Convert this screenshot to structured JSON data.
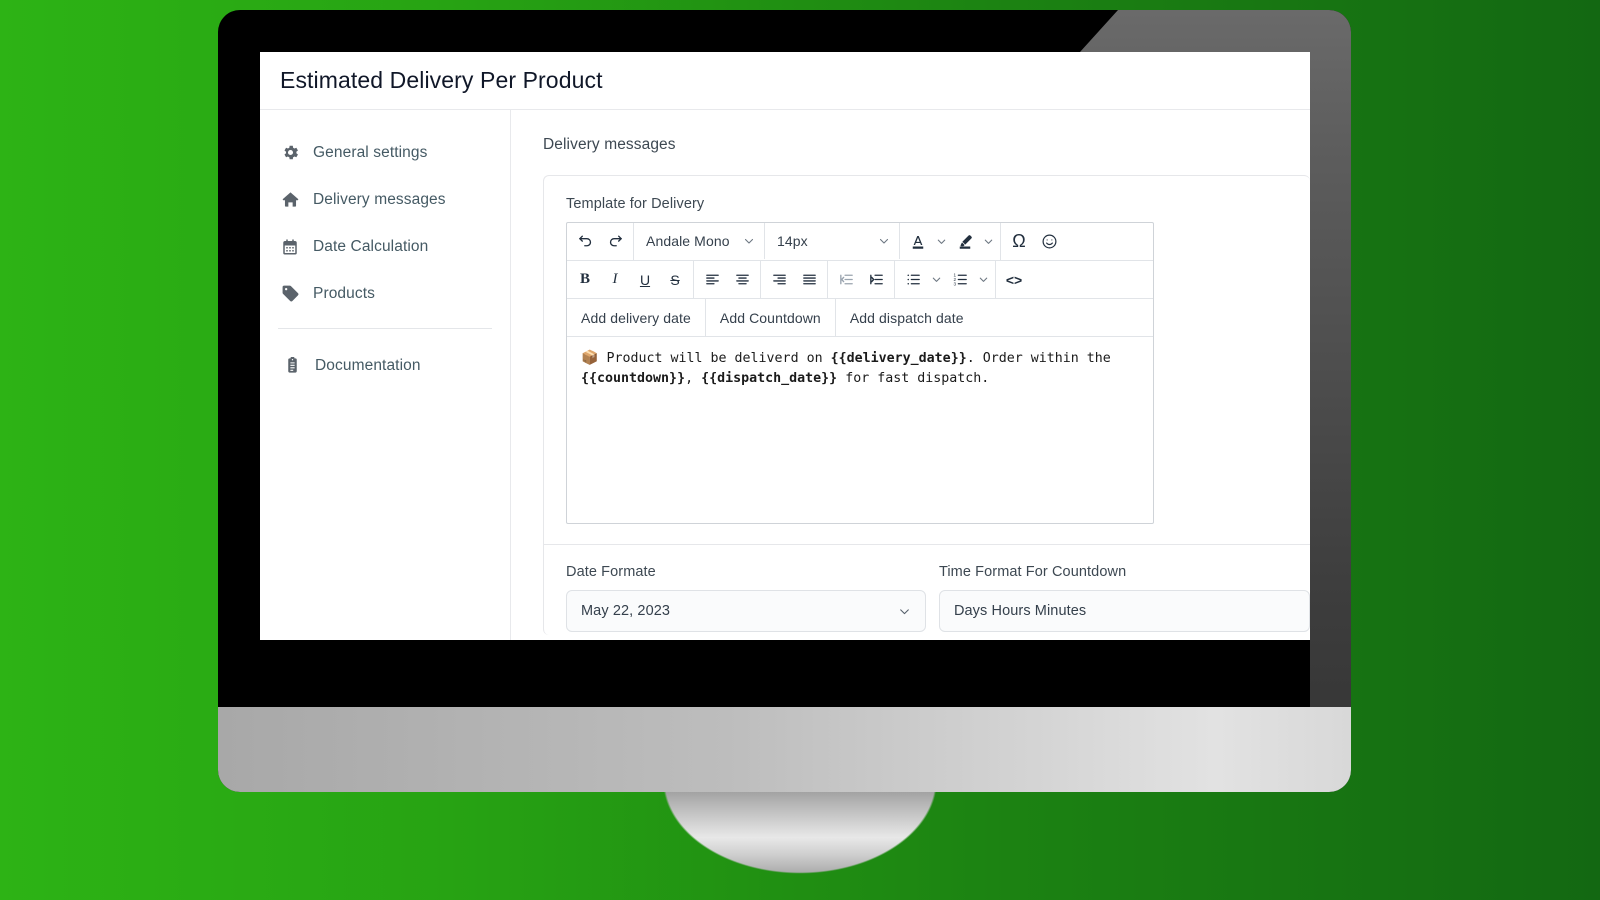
{
  "app": {
    "title": "Estimated Delivery Per Product"
  },
  "sidebar": {
    "items": [
      {
        "label": "General settings",
        "icon": "gear-icon"
      },
      {
        "label": "Delivery messages",
        "icon": "home-icon"
      },
      {
        "label": "Date Calculation",
        "icon": "calendar-icon"
      },
      {
        "label": "Products",
        "icon": "tag-icon"
      }
    ],
    "footer": {
      "label": "Documentation",
      "icon": "clipboard-icon"
    }
  },
  "main": {
    "section_title": "Delivery messages",
    "editor": {
      "label": "Template for Delivery",
      "font_family": "Andale Mono",
      "font_size": "14px",
      "toolbar_row1": [
        {
          "name": "undo-icon"
        },
        {
          "name": "redo-icon"
        },
        {
          "name": "text-color-icon"
        },
        {
          "name": "highlight-color-icon"
        },
        {
          "name": "special-character-icon",
          "glyph": "Ω"
        },
        {
          "name": "emoji-icon"
        }
      ],
      "toolbar_row2": [
        {
          "name": "bold-icon",
          "glyph": "B"
        },
        {
          "name": "italic-icon",
          "glyph": "I"
        },
        {
          "name": "underline-icon",
          "glyph": "U"
        },
        {
          "name": "strikethrough-icon",
          "glyph": "S"
        },
        {
          "name": "align-left-icon"
        },
        {
          "name": "align-center-icon"
        },
        {
          "name": "align-right-icon"
        },
        {
          "name": "align-justify-icon"
        },
        {
          "name": "outdent-icon"
        },
        {
          "name": "indent-icon"
        },
        {
          "name": "bullet-list-icon"
        },
        {
          "name": "numbered-list-icon"
        },
        {
          "name": "source-code-icon",
          "glyph": "<>"
        }
      ],
      "token_buttons": [
        "Add delivery date",
        "Add Countdown",
        "Add dispatch date"
      ],
      "content": {
        "emoji": "📦",
        "part1": " Product will be deliverd on ",
        "token1": "{{delivery_date}}",
        "part2": ". Order within the ",
        "token2": "{{countdown}}",
        "part3": ", ",
        "token3": "{{dispatch_date}}",
        "part4": " for fast dispatch."
      }
    },
    "fields": {
      "date_format": {
        "label": "Date Formate",
        "value": "May 22, 2023"
      },
      "time_format": {
        "label": "Time Format For Countdown",
        "value": "Days Hours Minutes"
      }
    }
  },
  "theme": {
    "background_start": "#2db315",
    "background_end": "#136812",
    "bezel": "#000000",
    "chin": "#bdbdbd",
    "text_primary": "#101728",
    "text_secondary": "#455a64",
    "icon_gray": "#5b636b",
    "border": "#e6e7ea"
  }
}
